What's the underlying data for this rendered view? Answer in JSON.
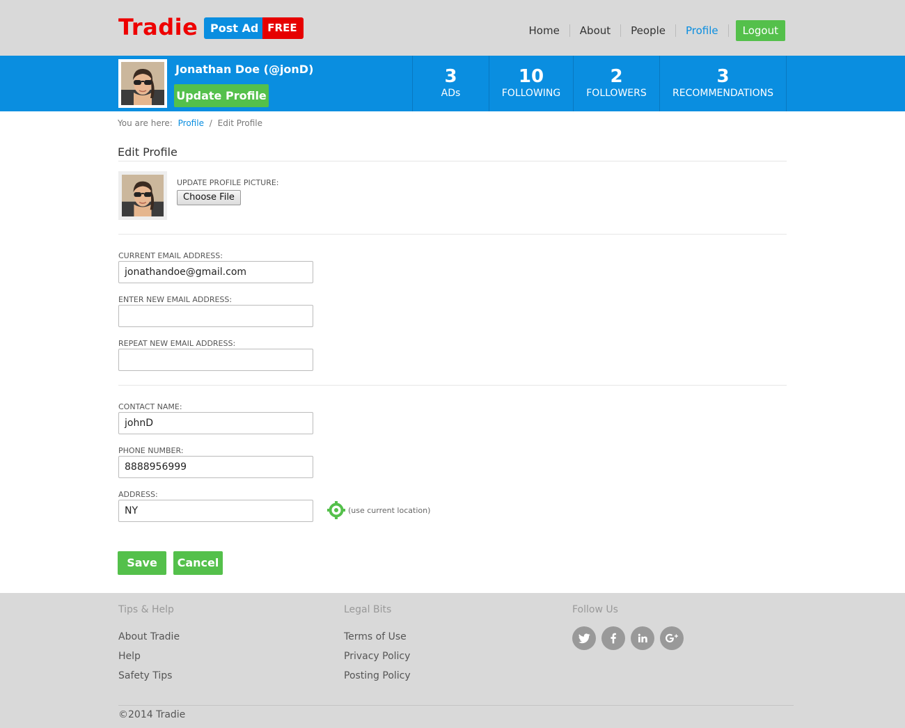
{
  "header": {
    "logo": "Tradie",
    "post_ad": "Post Ad",
    "free": "FREE",
    "nav": [
      "Home",
      "About",
      "People",
      "Profile"
    ],
    "active_nav": "Profile",
    "logout": "Logout"
  },
  "profile_bar": {
    "user_name": "Jonathan Doe (@jonD)",
    "update_button": "Update Profile",
    "stats": [
      {
        "num": "3",
        "label": "ADs"
      },
      {
        "num": "10",
        "label": "FOLLOWING"
      },
      {
        "num": "2",
        "label": "FOLLOWERS"
      },
      {
        "num": "3",
        "label": "RECOMMENDATIONS"
      }
    ]
  },
  "breadcrumb": {
    "prefix": "You are here:",
    "link": "Profile",
    "separator": "/",
    "current": "Edit Profile"
  },
  "form": {
    "title": "Edit Profile",
    "picture_label": "UPDATE PROFILE PICTURE:",
    "choose_file": "Choose File",
    "current_email_label": "CURRENT EMAIL ADDRESS:",
    "current_email_value": "jonathandoe@gmail.com",
    "new_email_label": "ENTER NEW EMAIL ADDRESS:",
    "new_email_value": "",
    "repeat_email_label": "REPEAT NEW EMAIL ADDRESS:",
    "repeat_email_value": "",
    "contact_name_label": "CONTACT NAME:",
    "contact_name_value": "johnD",
    "phone_label": "PHONE NUMBER:",
    "phone_value": "8888956999",
    "address_label": "ADDRESS:",
    "address_value": "NY",
    "use_location": "(use current location)",
    "save": "Save",
    "cancel": "Cancel"
  },
  "footer": {
    "col1_title": "Tips & Help",
    "col1_links": [
      "About Tradie",
      "Help",
      "Safety Tips"
    ],
    "col2_title": "Legal Bits",
    "col2_links": [
      "Terms of Use",
      "Privacy Policy",
      "Posting Policy"
    ],
    "col3_title": "Follow Us",
    "social_icons": [
      "twitter-icon",
      "facebook-icon",
      "linkedin-icon",
      "google-plus-icon"
    ],
    "copyright": "©2014 Tradie"
  },
  "colors": {
    "brand_red": "#e00000",
    "primary_blue": "#0a8ee0",
    "action_green": "#54c04b"
  }
}
